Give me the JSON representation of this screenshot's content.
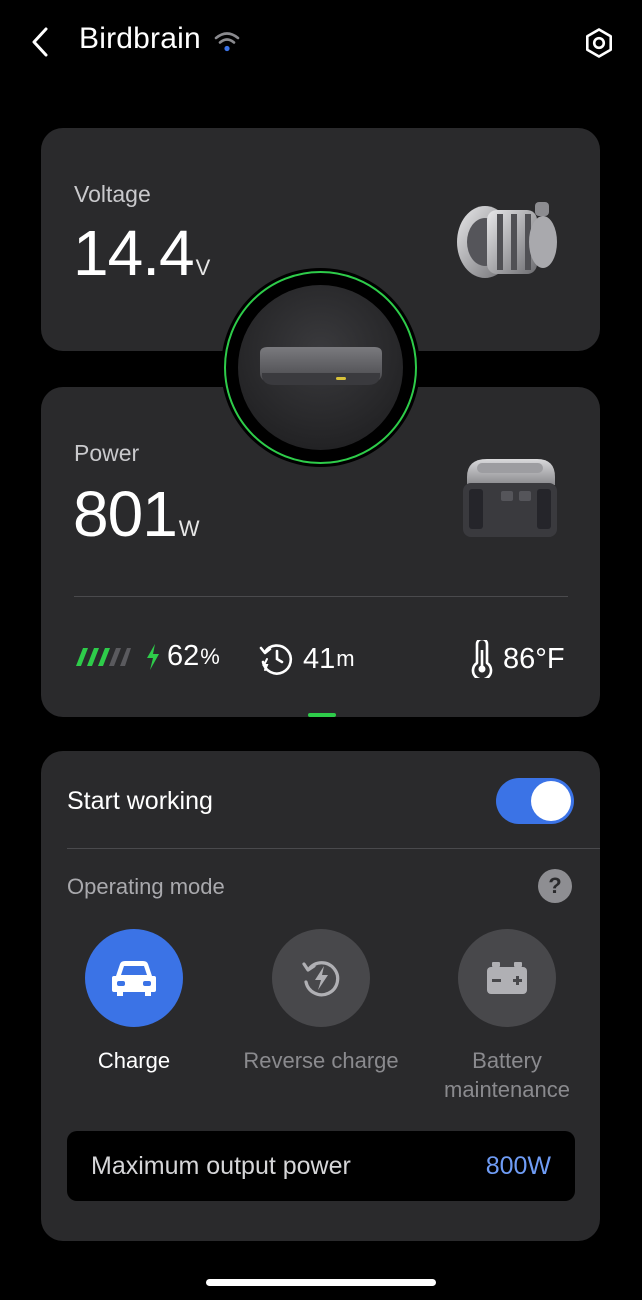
{
  "header": {
    "title": "Birdbrain"
  },
  "voltage": {
    "label": "Voltage",
    "value": "14.4",
    "unit": "V"
  },
  "power": {
    "label": "Power",
    "value": "801",
    "unit": "W"
  },
  "stats": {
    "battery_percent": "62",
    "battery_percent_unit": "%",
    "battery_level_fraction": 0.62,
    "time_value": "41",
    "time_unit": "m",
    "temperature": "86°F"
  },
  "controls": {
    "start_working_label": "Start working",
    "start_working_on": true,
    "operating_mode_label": "Operating mode",
    "help_glyph": "?",
    "modes": [
      {
        "label": "Charge",
        "icon": "car-icon",
        "active": true
      },
      {
        "label": "Reverse charge",
        "icon": "reverse-charge-icon",
        "active": false
      },
      {
        "label_line1": "Battery",
        "label_line2": "maintenance",
        "icon": "battery-icon",
        "active": false
      }
    ],
    "max_output_label": "Maximum output power",
    "max_output_value": "800W"
  },
  "colors": {
    "accent_blue": "#3b73e6",
    "ring_green": "#2ecc4a",
    "card_bg": "#2a2a2c"
  }
}
